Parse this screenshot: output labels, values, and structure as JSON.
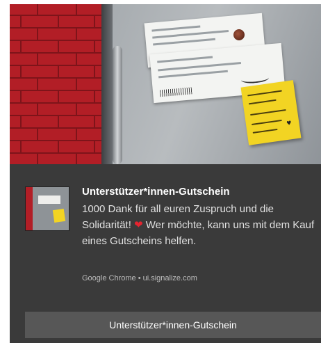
{
  "notification": {
    "title": "Unterstützer*innen-Gutschein",
    "body_part1": "1000 Dank für all euren Zuspruch und die Solidarität!",
    "body_part2": "Wer möchte, kann uns mit dem Kauf eines Gutscheins helfen.",
    "emoji": "❤",
    "attribution": "Google Chrome • ui.signalize.com",
    "action_label": "Unterstützer*innen-Gutschein",
    "hero_image": "fridge-with-tickets-and-sticky-note",
    "app_logo_image": "fridge-thumbnail"
  },
  "colors": {
    "background": "#3a3a3a",
    "button": "#575757",
    "heart": "#e4242f",
    "brick": "#b21e26",
    "sticky_note": "#f2d423"
  }
}
